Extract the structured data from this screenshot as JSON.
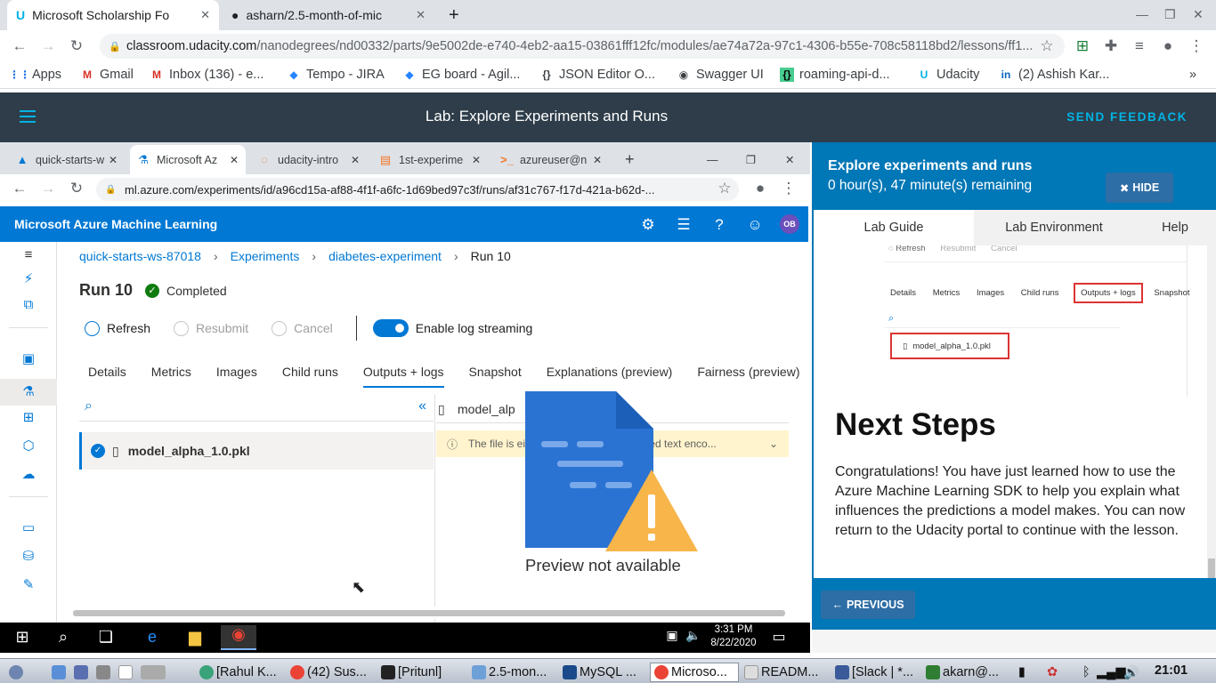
{
  "outer_tabs": [
    {
      "label": "Microsoft Scholarship Fo",
      "active": true
    },
    {
      "label": "asharn/2.5-month-of-mic",
      "active": false
    }
  ],
  "outer_url": {
    "host": "classroom.udacity.com",
    "path": "/nanodegrees/nd00332/parts/9e5002de-e740-4eb2-aa15-03861fff12fc/modules/ae74a72a-97c1-4306-b55e-708c58118bd2/lessons/ff1..."
  },
  "bookmarks": [
    "Apps",
    "Gmail",
    "Inbox (136) - e...",
    "Tempo - JIRA",
    "EG board - Agil...",
    "JSON Editor O...",
    "Swagger UI",
    "roaming-api-d...",
    "Udacity",
    "(2) Ashish Kar..."
  ],
  "udacity": {
    "lab_title": "Lab: Explore Experiments and Runs",
    "send_feedback": "SEND FEEDBACK"
  },
  "inner_tabs": [
    "quick-starts-w",
    "Microsoft Az",
    "udacity-intro",
    "1st-experime",
    "azureuser@n"
  ],
  "inner_url": "ml.azure.com/experiments/id/a96cd15a-af88-4f1f-a6fc-1d69bed97c3f/runs/af31c767-f17d-421a-b62d-...",
  "azure": {
    "title": "Microsoft Azure Machine Learning",
    "avatar": "OB",
    "breadcrumb": [
      "quick-starts-ws-87018",
      "Experiments",
      "diabetes-experiment",
      "Run 10"
    ],
    "run_title": "Run 10",
    "status": "Completed",
    "commands": {
      "refresh": "Refresh",
      "resubmit": "Resubmit",
      "cancel": "Cancel",
      "log_streaming": "Enable log streaming"
    },
    "tabs": [
      "Details",
      "Metrics",
      "Images",
      "Child runs",
      "Outputs + logs",
      "Snapshot",
      "Explanations (preview)",
      "Fairness (preview)"
    ],
    "active_tab": "Outputs + logs",
    "file": "model_alpha_1.0.pkl",
    "viewer_file": "model_alp",
    "warning_left": "The file is ei",
    "warning_right": "pported text enco...",
    "preview": "Preview not available"
  },
  "lab_panel": {
    "title": "Explore experiments and runs",
    "time_remaining": "0 hour(s), 47 minute(s) remaining",
    "hide": "HIDE",
    "tabs": [
      "Lab Guide",
      "Lab Environment",
      "Help"
    ],
    "thumb": {
      "refresh": "Refresh",
      "resubmit": "Resubmit",
      "cancel": "Cancel",
      "tabs": [
        "Details",
        "Metrics",
        "Images",
        "Child runs",
        "Outputs + logs",
        "Snapshot"
      ],
      "file": "model_alpha_1.0.pkl"
    },
    "heading": "Next Steps",
    "body": "Congratulations! You have just learned how to use the Azure Machine Learning SDK to help you explain what influences the predictions a model makes. You can now return to the Udacity portal to continue with the lesson.",
    "previous": "PREVIOUS"
  },
  "win_clock": {
    "time": "3:31 PM",
    "date": "8/22/2020"
  },
  "host_taskbar": [
    "[Rahul K...",
    "(42) Sus...",
    "[Pritunl]",
    "2.5-mon...",
    "MySQL ...",
    "Microso...",
    "READM...",
    "[Slack | *...",
    "akarn@..."
  ],
  "host_clock": "21:01",
  "colors": {
    "azure_blue": "#0078d4",
    "udacity_dark": "#2e3d49",
    "udacity_cyan": "#02b3e4",
    "lab_blue": "#0077b6",
    "success": "#107c10",
    "warning_bg": "#fff4ce"
  }
}
